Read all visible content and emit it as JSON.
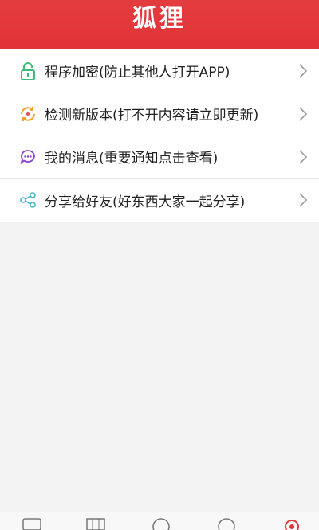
{
  "header": {
    "title": "狐狸"
  },
  "menu": {
    "items": [
      {
        "icon": "lock-icon",
        "label": "程序加密(防止其他人打开APP)"
      },
      {
        "icon": "refresh-icon",
        "label": "检测新版本(打不开内容请立即更新)"
      },
      {
        "icon": "message-icon",
        "label": "我的消息(重要通知点击查看)"
      },
      {
        "icon": "share-icon",
        "label": "分享给好友(好东西大家一起分享)"
      }
    ]
  },
  "bottom_nav": {
    "items": [
      "home-icon",
      "grid-icon",
      "circle-icon",
      "profile-icon",
      "settings-icon"
    ]
  },
  "colors": {
    "header": "#e23337",
    "lock": "#3dbb7a",
    "refresh": "#f0a030",
    "message": "#8a3fd0",
    "share": "#3fb6d0"
  }
}
